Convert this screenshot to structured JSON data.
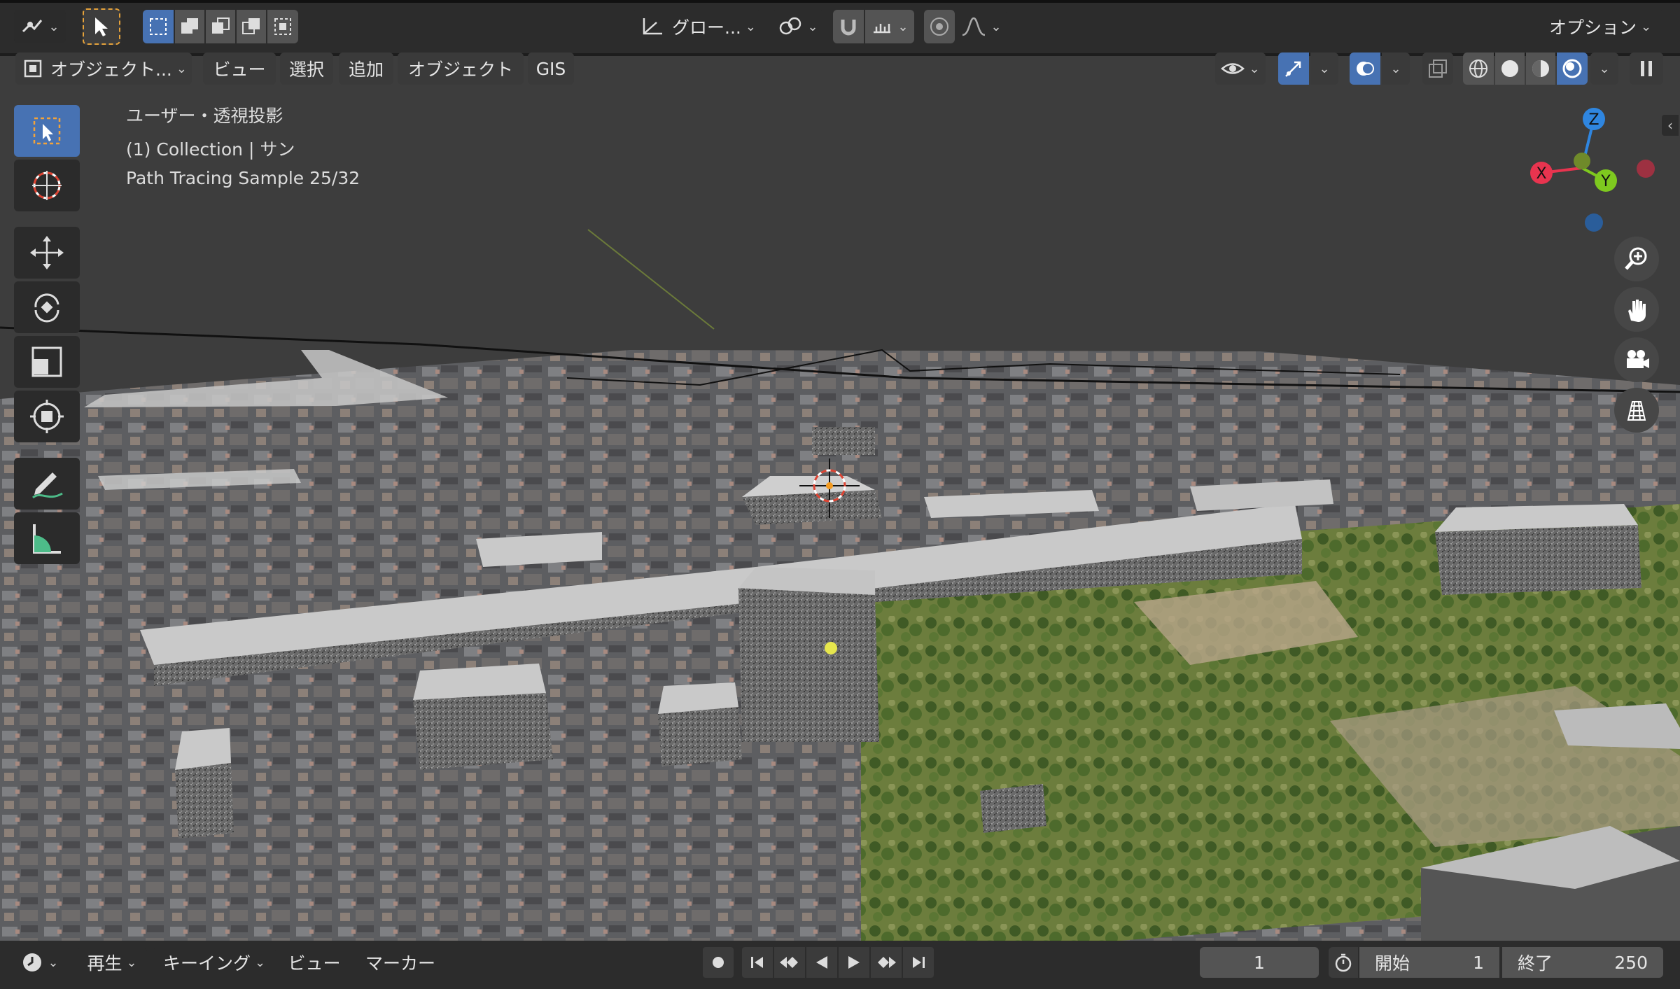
{
  "topbar": {
    "transform_orientation": "グロー...",
    "options_label": "オプション"
  },
  "header_menu": {
    "mode_label": "オブジェクト...",
    "view": "ビュー",
    "select": "選択",
    "add": "追加",
    "object": "オブジェクト",
    "gis": "GIS"
  },
  "overlay_text": {
    "view_name": "ユーザー・透視投影",
    "collection": "(1) Collection | サン",
    "render_status": "Path Tracing Sample 25/32"
  },
  "gizmo": {
    "z": "Z",
    "x": "X",
    "y": "Y",
    "colors": {
      "x": "#e8344f",
      "y": "#7ec91f",
      "z": "#2f86e0"
    }
  },
  "timeline": {
    "playback": "再生",
    "keying": "キーイング",
    "view": "ビュー",
    "marker": "マーカー",
    "current_frame": "1",
    "start_label": "開始",
    "start_value": "1",
    "end_label": "終了",
    "end_value": "250"
  },
  "colors": {
    "accent": "#4772b3",
    "header": "#303030",
    "button": "#545454"
  }
}
